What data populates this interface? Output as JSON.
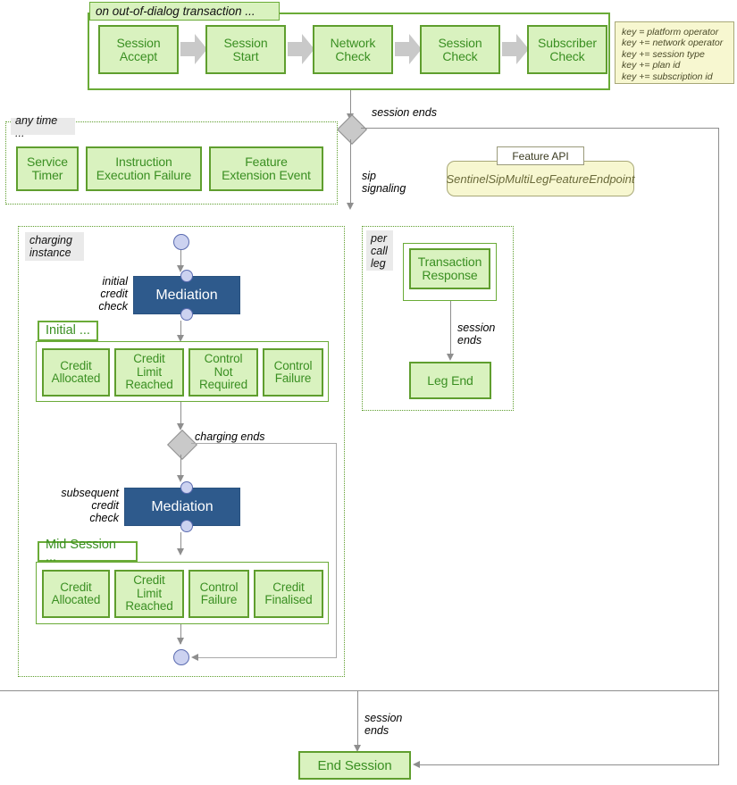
{
  "top_region": {
    "label": "on out-of-dialog transaction ...",
    "steps": [
      {
        "label": "Session\nAccept"
      },
      {
        "label": "Session\nStart"
      },
      {
        "label": "Network\nCheck"
      },
      {
        "label": "Session\nCheck"
      },
      {
        "label": "Subscriber\nCheck"
      }
    ]
  },
  "key_note": {
    "text": "key = platform operator\nkey += network operator\nkey += session type\nkey += plan id\nkey += subscription id"
  },
  "any_time_region": {
    "label": "any time ...",
    "items": [
      {
        "label": "Service\nTimer"
      },
      {
        "label": "Instruction\nExecution Failure"
      },
      {
        "label": "Feature\nExtension Event"
      }
    ]
  },
  "feature_api": {
    "tab_label": "Feature API",
    "endpoint": "SentinelSipMultiLegFeatureEndpoint"
  },
  "charging_instance": {
    "label": "charging\ninstance",
    "initial_edge_label": "initial\ncredit\ncheck",
    "mediation_initial": "Mediation",
    "initial_group": {
      "label": "Initial ...",
      "items": [
        {
          "label": "Credit\nAllocated"
        },
        {
          "label": "Credit\nLimit\nReached"
        },
        {
          "label": "Control\nNot\nRequired"
        },
        {
          "label": "Control\nFailure"
        }
      ]
    },
    "charging_ends_label": "charging ends",
    "subsequent_edge_label": "subsequent\ncredit\ncheck",
    "mediation_subsequent": "Mediation",
    "mid_session_group": {
      "label": "Mid Session ...",
      "items": [
        {
          "label": "Credit\nAllocated"
        },
        {
          "label": "Credit\nLimit\nReached"
        },
        {
          "label": "Control\nFailure"
        },
        {
          "label": "Credit\nFinalised"
        }
      ]
    }
  },
  "per_call_leg": {
    "label": "per\ncall\nleg",
    "transaction_response": "Transaction\nResponse",
    "session_ends_label": "session\nends",
    "leg_end": "Leg End"
  },
  "edges": {
    "session_ends_top": "session ends",
    "sip_signaling": "sip\nsignaling",
    "session_ends_bottom": "session\nends"
  },
  "end_session": {
    "label": "End Session"
  },
  "colors": {
    "green_fill": "#d9f2bf",
    "green_border": "#5f9e2e",
    "green_text": "#3a8f22",
    "blue_fill": "#2e5a8c",
    "yellow_fill": "#f7f7d0",
    "pin_fill": "#ccd2f0",
    "diamond_fill": "#c9c9c9",
    "connector": "#8e8e8e"
  }
}
